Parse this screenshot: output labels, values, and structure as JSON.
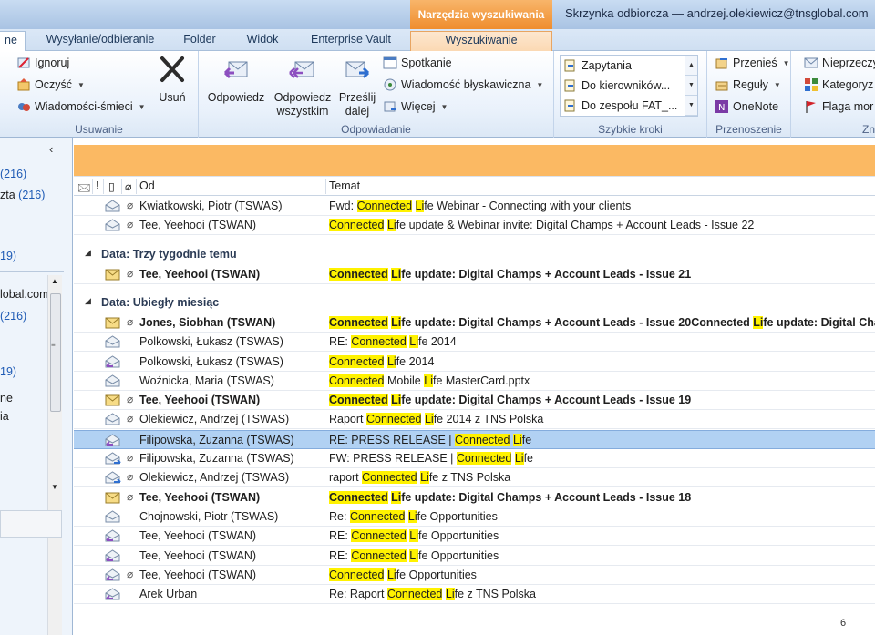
{
  "titlebar": {
    "context_tab": "Narzędzia wyszukiwania",
    "window_title": "Skrzynka odbiorcza — andrzej.olekiewicz@tnsglobal.com"
  },
  "tabs": {
    "home": "ne",
    "send_receive": "Wysyłanie/odbieranie",
    "folder": "Folder",
    "view": "Widok",
    "enterprise_vault": "Enterprise Vault",
    "search": "Wyszukiwanie"
  },
  "ribbon": {
    "delete_group": {
      "label": "Usuwanie",
      "ignore": "Ignoruj",
      "clean": "Oczyść",
      "junk": "Wiadomości-śmieci",
      "delete": "Usuń"
    },
    "respond_group": {
      "label": "Odpowiadanie",
      "reply": "Odpowiedz",
      "reply_all_1": "Odpowiedz",
      "reply_all_2": "wszystkim",
      "forward_1": "Prześlij",
      "forward_2": "dalej",
      "meeting": "Spotkanie",
      "im": "Wiadomość błyskawiczna",
      "more": "Więcej"
    },
    "quicksteps_group": {
      "label": "Szybkie kroki",
      "item1": "Zapytania",
      "item2": "Do kierowników...",
      "item3": "Do zespołu FAT_..."
    },
    "move_group": {
      "label": "Przenoszenie",
      "move": "Przenieś",
      "rules": "Reguły",
      "onenote": "OneNote"
    },
    "tags_group": {
      "label": "Zn",
      "unread": "Nieprzeczy",
      "categorize": "Kategoryz",
      "flag": "Flaga mor"
    }
  },
  "nav": {
    "items": [
      {
        "label": "",
        "count": "(216)"
      },
      {
        "label": "zta",
        "count": "(216)"
      },
      {
        "label": "",
        "count": "19)"
      },
      {
        "label": "lobal.com",
        "count": ""
      },
      {
        "label": "",
        "count": "(216)"
      },
      {
        "label": "",
        "count": "19)"
      },
      {
        "label": "ne",
        "count": ""
      },
      {
        "label": "ia",
        "count": ""
      }
    ]
  },
  "list": {
    "columns": {
      "from": "Od",
      "subject": "Temat"
    },
    "groups": {
      "three_weeks": "Data: Trzy tygodnie temu",
      "last_month": "Data: Ubiegły miesiąc"
    },
    "rows_top": [
      {
        "from": "Kwiatkowski, Piotr (TSWAS)",
        "s1": "Fwd: ",
        "h1": "Connected",
        "s2": " ",
        "h2": "Li",
        "s3": "fe Webinar - Connecting with your clients"
      },
      {
        "from": "Tee, Yeehooi (TSWAN)",
        "s1": "",
        "h1": "Connected",
        "s2": " ",
        "h2": "Li",
        "s3": "fe update & Webinar invite: Digital Champs + Account Leads - Issue 22"
      }
    ],
    "rows_three_weeks": [
      {
        "from": "Tee, Yeehooi (TSWAN)",
        "s1": "",
        "h1": "Connected",
        "s2": " ",
        "h2": "Li",
        "s3": "fe update: Digital Champs + Account Leads - Issue 21"
      }
    ],
    "rows_last_month": [
      {
        "from": "Jones, Siobhan (TSWAN)",
        "s1": "",
        "h1": "Connected",
        "s2": " ",
        "h2": "Li",
        "s3": "fe update: Digital Champs + Account Leads - Issue 20Connected ",
        "h3": "Li",
        "s4": "fe update: Digital Cham"
      },
      {
        "from": "Polkowski, Łukasz (TSWAS)",
        "s1": "RE: ",
        "h1": "Connected",
        "s2": " ",
        "h2": "Li",
        "s3": "fe 2014"
      },
      {
        "from": "Polkowski, Łukasz (TSWAS)",
        "s1": "",
        "h1": "Connected",
        "s2": " ",
        "h2": "Li",
        "s3": "fe 2014"
      },
      {
        "from": "Woźnicka, Maria (TSWAS)",
        "s1": "",
        "h1": "Connected",
        "s2": " Mobile ",
        "h2": "Li",
        "s3": "fe MasterCard.pptx"
      },
      {
        "from": "Tee, Yeehooi (TSWAN)",
        "s1": "",
        "h1": "Connected",
        "s2": " ",
        "h2": "Li",
        "s3": "fe update: Digital Champs + Account Leads - Issue 19"
      },
      {
        "from": "Olekiewicz, Andrzej (TSWAS)",
        "s1": "Raport ",
        "h1": "Connected",
        "s2": " ",
        "h2": "Li",
        "s3": "fe 2014 z TNS Polska"
      },
      {
        "from": "Filipowska, Zuzanna (TSWAS)",
        "s1": "RE: PRESS RELEASE | ",
        "h1": "Connected",
        "s2": " ",
        "h2": "Li",
        "s3": "fe"
      },
      {
        "from": "Filipowska, Zuzanna (TSWAS)",
        "s1": "FW: PRESS RELEASE | ",
        "h1": "Connected",
        "s2": " ",
        "h2": "Li",
        "s3": "fe"
      },
      {
        "from": "Olekiewicz, Andrzej (TSWAS)",
        "s1": "raport ",
        "h1": "Connected",
        "s2": " ",
        "h2": "Li",
        "s3": "fe z TNS Polska"
      },
      {
        "from": "Tee, Yeehooi (TSWAN)",
        "s1": "",
        "h1": "Connected",
        "s2": " ",
        "h2": "Li",
        "s3": "fe update: Digital Champs + Account Leads - Issue 18"
      },
      {
        "from": "Chojnowski, Piotr (TSWAS)",
        "s1": "Re: ",
        "h1": "Connected",
        "s2": " ",
        "h2": "Li",
        "s3": "fe Opportunities"
      },
      {
        "from": "Tee, Yeehooi (TSWAN)",
        "s1": "RE: ",
        "h1": "Connected",
        "s2": " ",
        "h2": "Li",
        "s3": "fe Opportunities"
      },
      {
        "from": "Tee, Yeehooi (TSWAN)",
        "s1": "RE: ",
        "h1": "Connected",
        "s2": " ",
        "h2": "Li",
        "s3": "fe Opportunities"
      },
      {
        "from": "Tee, Yeehooi (TSWAN)",
        "s1": "",
        "h1": "Connected",
        "s2": " ",
        "h2": "Li",
        "s3": "fe Opportunities"
      },
      {
        "from": "Arek Urban",
        "s1": "Re: Raport ",
        "h1": "Connected",
        "s2": " ",
        "h2": "Li",
        "s3": "fe z TNS Polska"
      }
    ]
  },
  "page_number": "6",
  "colors": {
    "highlight": "#fff200",
    "selected_row": "#b1d1f3",
    "search_bar": "#fbb963"
  }
}
